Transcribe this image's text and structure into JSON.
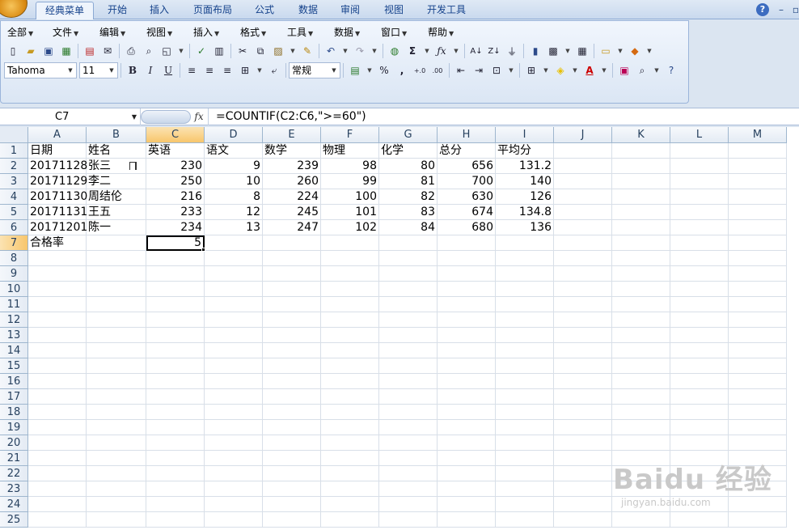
{
  "ribbon_tabs": [
    "经典菜单",
    "开始",
    "插入",
    "页面布局",
    "公式",
    "数据",
    "审阅",
    "视图",
    "开发工具"
  ],
  "menus": [
    "全部",
    "文件",
    "编辑",
    "视图",
    "插入",
    "格式",
    "工具",
    "数据",
    "窗口",
    "帮助"
  ],
  "format": {
    "font": "Tahoma",
    "size": "11",
    "number_format": "常规"
  },
  "formula_bar": {
    "name_box": "C7",
    "fx": "fx",
    "formula": "=COUNTIF(C2:C6,\">=60\")"
  },
  "columns": [
    "A",
    "B",
    "C",
    "D",
    "E",
    "F",
    "G",
    "H",
    "I",
    "J",
    "K",
    "L",
    "M"
  ],
  "rows": [
    "1",
    "2",
    "3",
    "4",
    "5",
    "6",
    "7",
    "8",
    "9",
    "10",
    "11",
    "12",
    "13",
    "14",
    "15",
    "16",
    "17",
    "18",
    "19",
    "20",
    "21",
    "22",
    "23",
    "24",
    "25"
  ],
  "sheet": {
    "header": [
      "日期",
      "姓名",
      "英语",
      "语文",
      "数学",
      "物理",
      "化学",
      "总分",
      "平均分"
    ],
    "data": [
      [
        "20171128",
        "张三",
        "230",
        "9",
        "239",
        "98",
        "80",
        "656",
        "131.2"
      ],
      [
        "20171129",
        "李二",
        "250",
        "10",
        "260",
        "99",
        "81",
        "700",
        "140"
      ],
      [
        "20171130",
        "周结伦",
        "216",
        "8",
        "224",
        "100",
        "82",
        "630",
        "126"
      ],
      [
        "20171131",
        "王五",
        "233",
        "12",
        "245",
        "101",
        "83",
        "674",
        "134.8"
      ],
      [
        "20171201",
        "陈一",
        "234",
        "13",
        "247",
        "102",
        "84",
        "680",
        "136"
      ]
    ],
    "summary_label": "合格率",
    "summary_value": "5"
  },
  "selected": {
    "col": "C",
    "row": "7"
  },
  "watermark": {
    "brand": "Baidu 经验",
    "url": "jingyan.baidu.com"
  },
  "colors": {
    "accent": "#15428b",
    "selection": "#f8c66c"
  }
}
